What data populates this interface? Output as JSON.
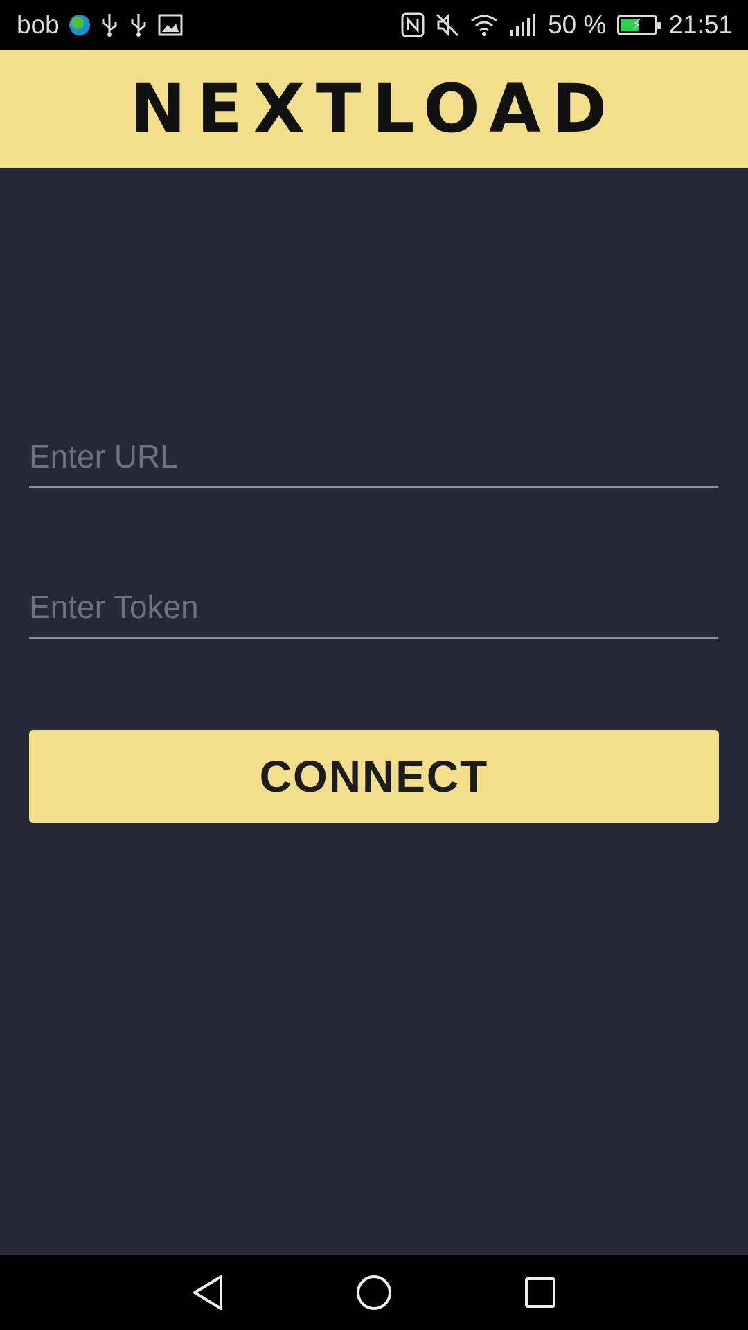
{
  "status_bar": {
    "carrier": "bob",
    "battery_percent": "50 %",
    "battery_level": 0.5,
    "time": "21:51",
    "icons": [
      "globe-icon",
      "usb-icon",
      "usb-icon",
      "gallery-icon",
      "nfc-icon",
      "mute-icon",
      "wifi-icon",
      "signal-icon",
      "battery-icon"
    ]
  },
  "header": {
    "logo_text": "NEXTLOAD",
    "background": "#f3df8b"
  },
  "form": {
    "url_placeholder": "Enter URL",
    "url_value": "",
    "token_placeholder": "Enter Token",
    "token_value": "",
    "connect_label": "CONNECT"
  },
  "nav_bar": {
    "icons": [
      "back-icon",
      "home-icon",
      "recents-icon"
    ]
  },
  "colors": {
    "accent": "#f3df8b",
    "background": "#272837",
    "placeholder": "#6f7180"
  }
}
